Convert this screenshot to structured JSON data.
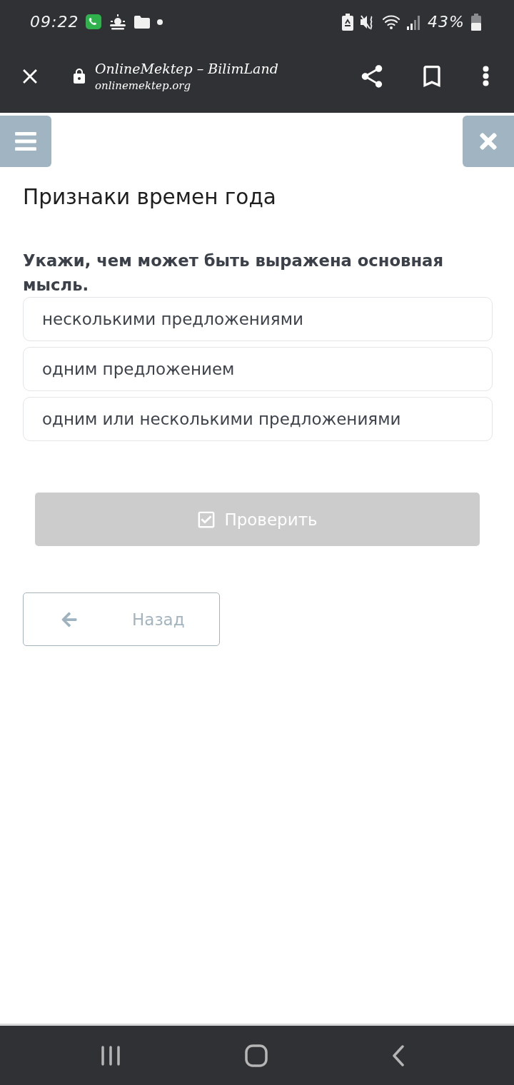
{
  "status_bar": {
    "time": "09:22",
    "battery": "43%"
  },
  "browser": {
    "title": "OnlineMektep – BilimLand",
    "url": "onlinemektep.org"
  },
  "page": {
    "title": "Признаки времен года"
  },
  "question": {
    "text": "Укажи, чем может быть выражена основная мысль.",
    "options": [
      {
        "label": "несколькими предложениями",
        "selected": false
      },
      {
        "label": "одним предложением",
        "selected": false
      },
      {
        "label": "одним или несколькими предложениями",
        "selected": false
      }
    ]
  },
  "check_button": {
    "label": "Проверить",
    "disabled": true
  },
  "back_button": {
    "label": "Назад"
  }
}
